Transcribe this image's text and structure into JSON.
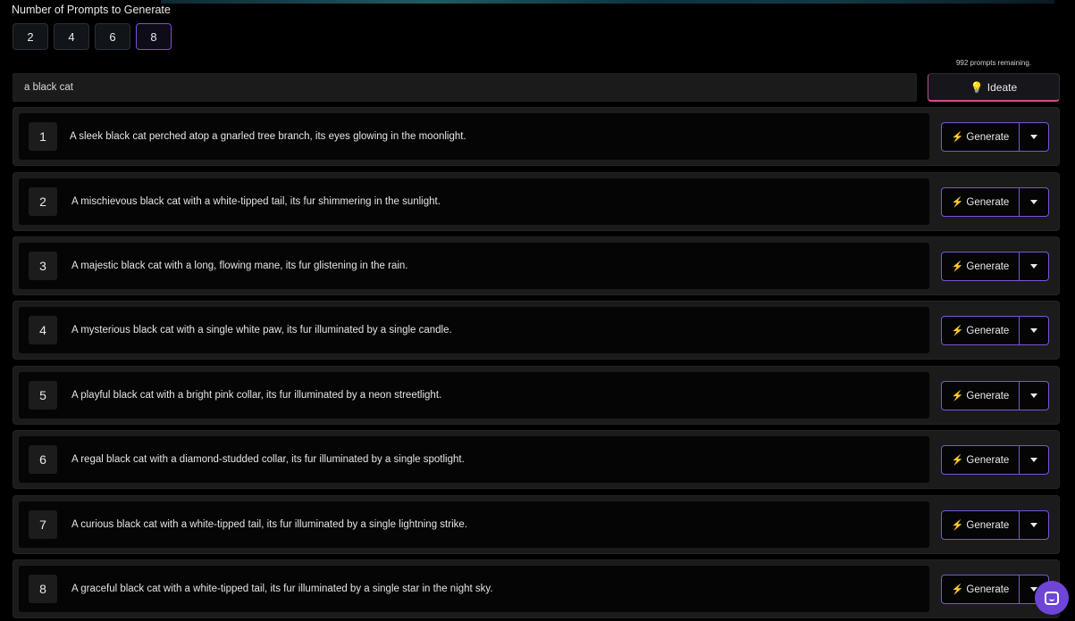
{
  "header": {
    "count_label": "Number of Prompts to Generate",
    "count_options": [
      "2",
      "4",
      "6",
      "8"
    ],
    "selected_count": "8"
  },
  "search": {
    "value": "a black cat",
    "remaining_text": "992 prompts remaining.",
    "ideate_label": "Ideate",
    "ideate_icon": "lightbulb-icon"
  },
  "prompts": [
    {
      "number": "1",
      "text": "A sleek black cat perched atop a gnarled tree branch, its eyes glowing in the moonlight."
    },
    {
      "number": "2",
      "text": "A mischievous black cat with a white-tipped tail, its fur shimmering in the sunlight."
    },
    {
      "number": "3",
      "text": "A majestic black cat with a long, flowing mane, its fur glistening in the rain."
    },
    {
      "number": "4",
      "text": "A mysterious black cat with a single white paw, its fur illuminated by a single candle."
    },
    {
      "number": "5",
      "text": "A playful black cat with a bright pink collar, its fur illuminated by a neon streetlight."
    },
    {
      "number": "6",
      "text": "A regal black cat with a diamond-studded collar, its fur illuminated by a single spotlight."
    },
    {
      "number": "7",
      "text": "A curious black cat with a white-tipped tail, its fur illuminated by a single lightning strike."
    },
    {
      "number": "8",
      "text": "A graceful black cat with a white-tipped tail, its fur illuminated by a single star in the night sky."
    }
  ],
  "generate_label": "Generate",
  "generate_icon": "lightning-icon",
  "colors": {
    "accent": "#7a55d8",
    "bolt": "#f2b632",
    "chat": "#6f45d8"
  }
}
